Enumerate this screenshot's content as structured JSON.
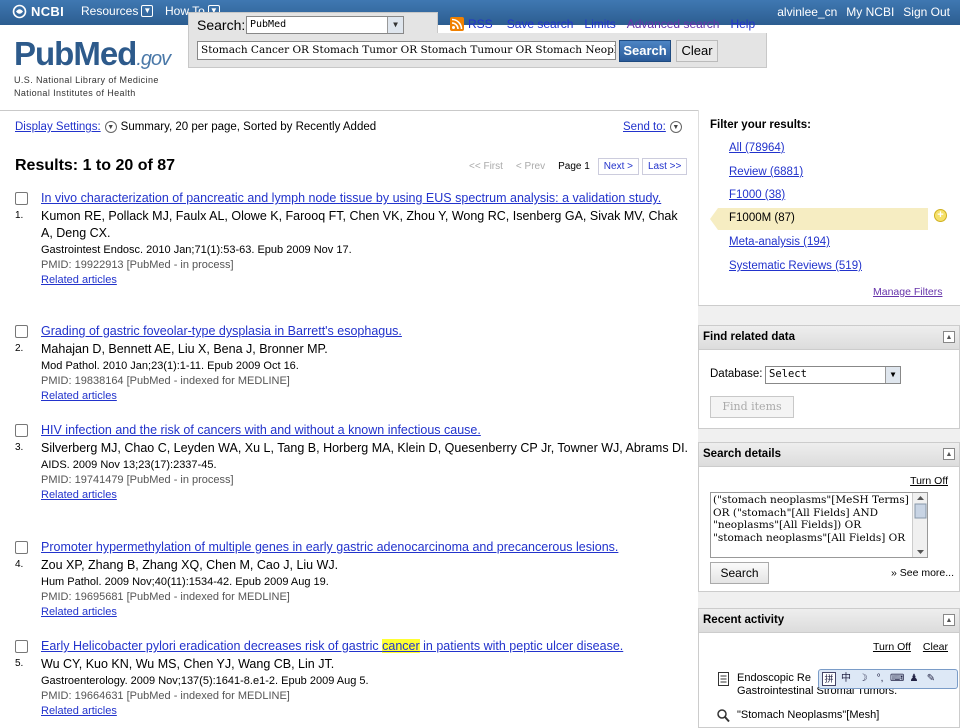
{
  "topbar": {
    "logo": "NCBI",
    "menus": [
      "Resources",
      "How To"
    ],
    "user": "alvinlee_cn",
    "my_ncbi": "My NCBI",
    "sign_out": "Sign Out"
  },
  "header": {
    "logo_main": "PubMed",
    "logo_gov": ".gov",
    "org_line1": "U.S. National Library of Medicine",
    "org_line2": "National Institutes of Health",
    "search_label": "Search:",
    "database": "PubMed",
    "query": "Stomach Cancer OR Stomach Tumor OR Stomach Tumour OR Stomach Neoplasms",
    "search_button": "Search",
    "clear_button": "Clear",
    "links": {
      "rss": "RSS",
      "save_search": "Save search",
      "limits": "Limits",
      "advanced": "Advanced search",
      "help": "Help"
    }
  },
  "results_bar": {
    "display_settings": "Display Settings:",
    "display_summary": "Summary, 20 per page, Sorted by Recently Added",
    "send_to": "Send to:",
    "title": "Results: 1 to 20 of 87",
    "pager": {
      "first": "<< First",
      "prev": "< Prev",
      "current": "Page 1",
      "next": "Next >",
      "last": "Last >>"
    }
  },
  "results": [
    {
      "num": "1.",
      "title": "In vivo characterization of pancreatic and lymph node tissue by using EUS spectrum analysis: a validation study.",
      "authors": "Kumon RE, Pollack MJ, Faulx AL, Olowe K, Farooq FT, Chen VK, Zhou Y, Wong RC, Isenberg GA, Sivak MV, Chak A, Deng CX.",
      "journal": "Gastrointest Endosc. 2010 Jan;71(1):53-63. Epub 2009 Nov 17.",
      "pmid": "PMID: 19922913 [PubMed - in process]",
      "related": "Related articles"
    },
    {
      "num": "2.",
      "title": "Grading of gastric foveolar-type dysplasia in Barrett's esophagus.",
      "authors": "Mahajan D, Bennett AE, Liu X, Bena J, Bronner MP.",
      "journal": "Mod Pathol. 2010 Jan;23(1):1-11. Epub 2009 Oct 16.",
      "pmid": "PMID: 19838164 [PubMed - indexed for MEDLINE]",
      "related": "Related articles"
    },
    {
      "num": "3.",
      "title": "HIV infection and the risk of cancers with and without a known infectious cause.",
      "authors": "Silverberg MJ, Chao C, Leyden WA, Xu L, Tang B, Horberg MA, Klein D, Quesenberry CP Jr, Towner WJ, Abrams DI.",
      "journal": "AIDS. 2009 Nov 13;23(17):2337-45.",
      "pmid": "PMID: 19741479 [PubMed - in process]",
      "related": "Related articles"
    },
    {
      "num": "4.",
      "title": "Promoter hypermethylation of multiple genes in early gastric adenocarcinoma and precancerous lesions.",
      "authors": "Zou XP, Zhang B, Zhang XQ, Chen M, Cao J, Liu WJ.",
      "journal": "Hum Pathol. 2009 Nov;40(11):1534-42. Epub 2009 Aug 19.",
      "pmid": "PMID: 19695681 [PubMed - indexed for MEDLINE]",
      "related": "Related articles"
    },
    {
      "num": "5.",
      "title_before": "Early Helicobacter pylori eradication decreases risk of gastric ",
      "title_highlight": "cancer",
      "title_after": " in patients with peptic ulcer disease.",
      "authors": "Wu CY, Kuo KN, Wu MS, Chen YJ, Wang CB, Lin JT.",
      "journal": "Gastroenterology. 2009 Nov;137(5):1641-8.e1-2. Epub 2009 Aug 5.",
      "pmid": "PMID: 19664631 [PubMed - indexed for MEDLINE]",
      "related": "Related articles"
    }
  ],
  "filters": {
    "title": "Filter your results:",
    "items": [
      "All (78964)",
      "Review (6881)",
      "F1000 (38)",
      "F1000M (87)",
      "Meta-analysis (194)",
      "Systematic Reviews (519)"
    ],
    "active_index": 3,
    "manage": "Manage Filters"
  },
  "related_data": {
    "title": "Find related data",
    "db_label": "Database:",
    "db_value": "Select",
    "find_button": "Find items"
  },
  "search_details": {
    "title": "Search details",
    "turn_off": "Turn Off",
    "text": "(\"stomach neoplasms\"[MeSH Terms] OR (\"stomach\"[All Fields] AND \"neoplasms\"[All Fields]) OR \"stomach neoplasms\"[All Fields] OR",
    "search_button": "Search",
    "see_more": "» See more..."
  },
  "recent_activity": {
    "title": "Recent activity",
    "turn_off": "Turn Off",
    "clear": "Clear",
    "item1_line1": "Endoscopic Re",
    "item1_line2": "Gastrointestinal Stromal Tumors.",
    "item2": "\"Stomach Neoplasms\"[Mesh]"
  },
  "ime": {
    "mode": "中"
  },
  "colors": {
    "ncbi_bar": "#336699",
    "link": "#2233cc",
    "visited": "#6633aa",
    "highlight": "#ffff33",
    "active_filter": "#f6edc2"
  }
}
